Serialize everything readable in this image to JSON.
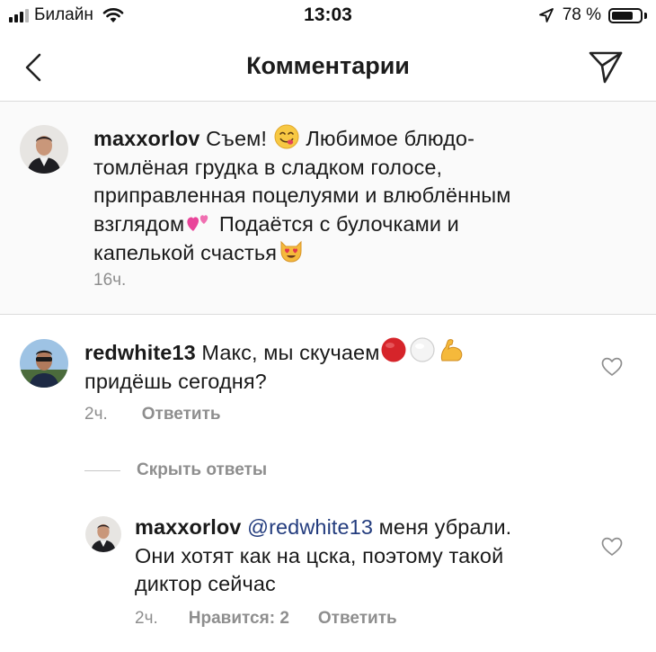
{
  "status_bar": {
    "carrier": "Билайн",
    "time": "13:03",
    "battery_percent": "78 %",
    "battery_level": 0.78
  },
  "header": {
    "title": "Комментарии"
  },
  "caption": {
    "username": "maxxorlov",
    "line1_a": "Съем!",
    "line1_b": "Любимое блюдо-",
    "line2": "томлёная грудка в сладком голосе,",
    "line3": "приправленная поцелуями и влюблённым",
    "line4_a": "взглядом",
    "line4_b": "Подаётся с булочками и",
    "line5": "капелькой счастья",
    "time": "16ч."
  },
  "comments": [
    {
      "username": "redwhite13",
      "line1": "Макс, мы скучаем",
      "line2": "придёшь сегодня?",
      "time": "2ч.",
      "reply_label": "Ответить"
    }
  ],
  "hide_replies_label": "Скрыть ответы",
  "reply": {
    "username": "maxxorlov",
    "mention": "@redwhite13",
    "line1_rest": "меня убрали.",
    "line2": "Они хотят как на цска, поэтому такой",
    "line3": "диктор сейчас",
    "time": "2ч.",
    "likes_label": "Нравится: 2",
    "reply_label": "Ответить"
  },
  "icons": {
    "back": "chevron-left-icon",
    "send": "paper-plane-icon",
    "like": "heart-outline-icon",
    "location": "location-arrow-icon",
    "wifi": "wifi-icon"
  }
}
